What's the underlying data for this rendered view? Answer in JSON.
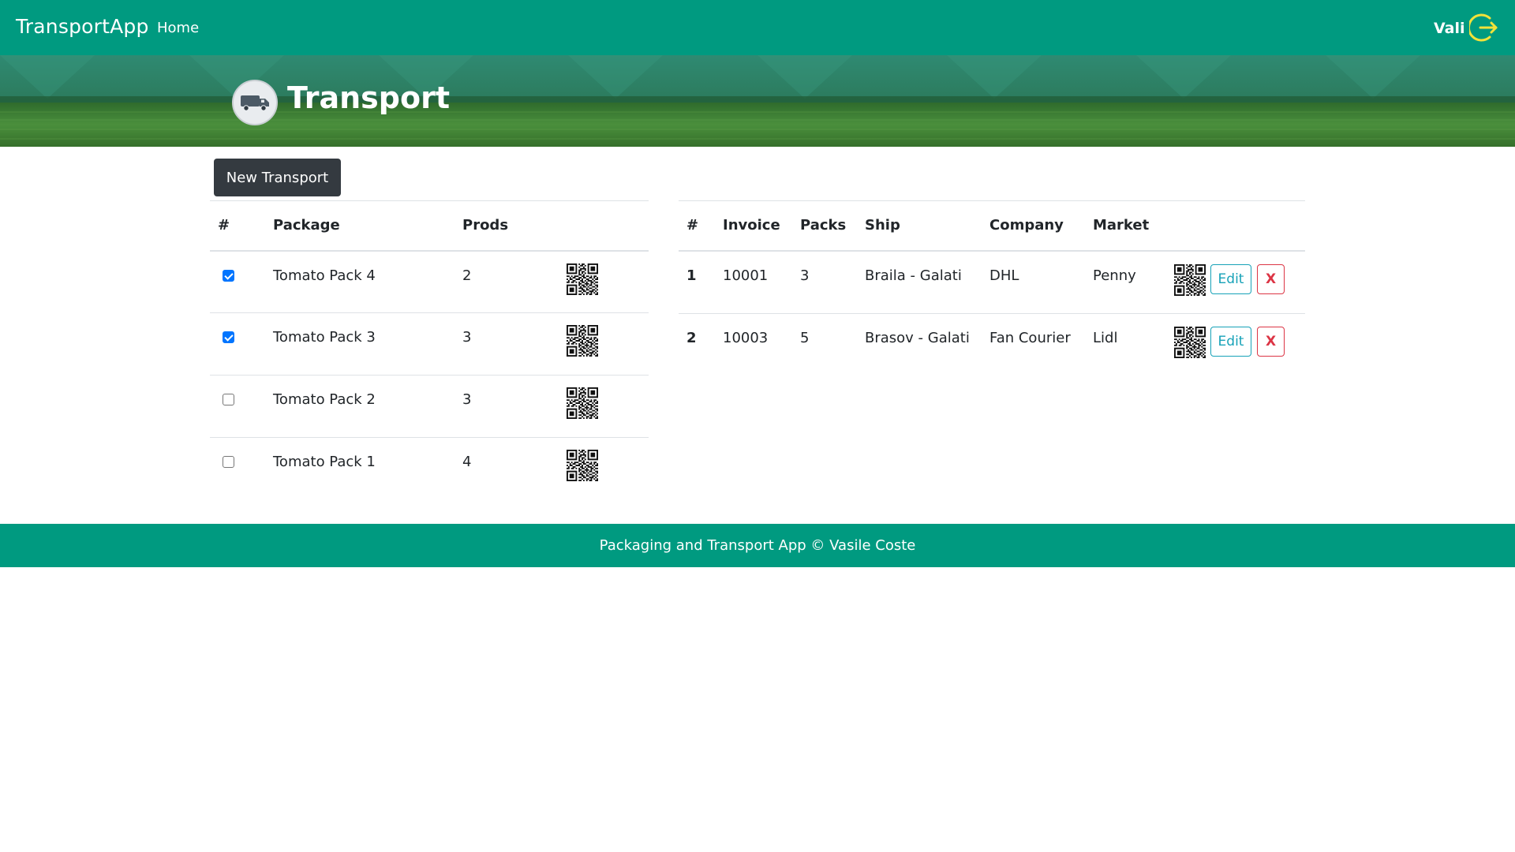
{
  "navbar": {
    "brand": "TransportApp",
    "home_label": "Home",
    "user_name": "Vali",
    "logout_icon": "logout-icon",
    "color": "#009a80",
    "icon_color": "#f2e23a"
  },
  "hero": {
    "title": "Transport",
    "icon": "truck-icon"
  },
  "actions": {
    "new_transport_label": "New Transport"
  },
  "packages": {
    "headers": [
      "#",
      "Package",
      "Prods"
    ],
    "rows": [
      {
        "checked": true,
        "name": "Tomato Pack 4",
        "prods": "2"
      },
      {
        "checked": true,
        "name": "Tomato Pack 3",
        "prods": "3"
      },
      {
        "checked": false,
        "name": "Tomato Pack 2",
        "prods": "3"
      },
      {
        "checked": false,
        "name": "Tomato Pack 1",
        "prods": "4"
      }
    ]
  },
  "transports": {
    "headers": [
      "#",
      "Invoice",
      "Packs",
      "Ship",
      "Company",
      "Market"
    ],
    "edit_label": "Edit",
    "delete_label": "X",
    "rows": [
      {
        "num": "1",
        "invoice": "10001",
        "packs": "3",
        "ship": "Braila - Galati",
        "company": "DHL",
        "market": "Penny"
      },
      {
        "num": "2",
        "invoice": "10003",
        "packs": "5",
        "ship": "Brasov - Galati",
        "company": "Fan Courier",
        "market": "Lidl"
      }
    ]
  },
  "footer": {
    "text": "Packaging and Transport App © Vasile Coste"
  }
}
